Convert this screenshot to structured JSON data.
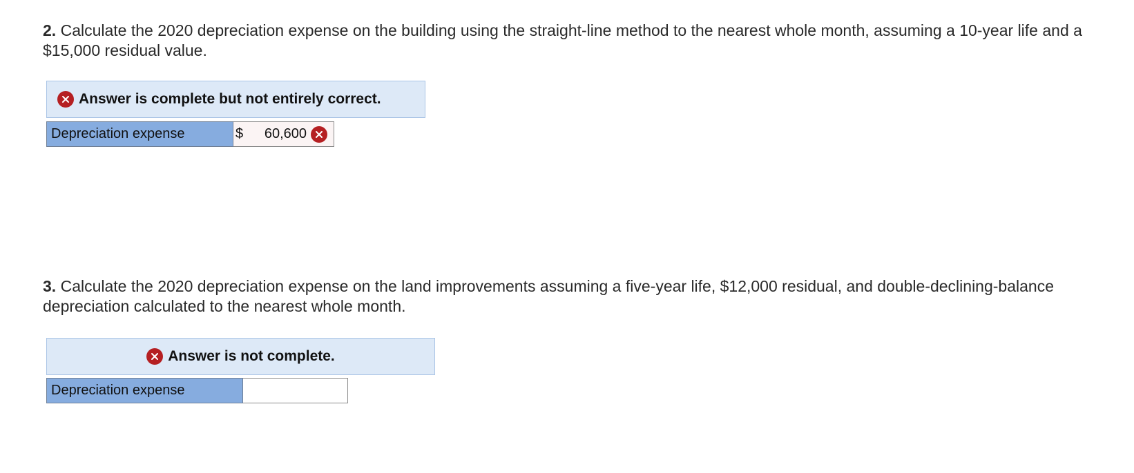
{
  "q2": {
    "number": "2.",
    "text": " Calculate the 2020 depreciation expense on the building using the straight-line method to the nearest whole month, assuming a 10-year life and a $15,000 residual value.",
    "banner": "Answer is complete but not entirely correct.",
    "row_label": "Depreciation expense",
    "currency": "$",
    "value": "60,600",
    "status": "incorrect"
  },
  "q3": {
    "number": "3.",
    "text": " Calculate the 2020 depreciation expense on the land improvements assuming a five-year life, $12,000 residual, and double-declining-balance depreciation calculated to the nearest whole month.",
    "banner": "Answer is not complete.",
    "row_label": "Depreciation expense",
    "value": ""
  },
  "icons": {
    "status_icon": "close-circle-icon",
    "status_color": "#b51f22",
    "banner_bg": "#dde9f7",
    "label_bg": "#86acdf"
  }
}
